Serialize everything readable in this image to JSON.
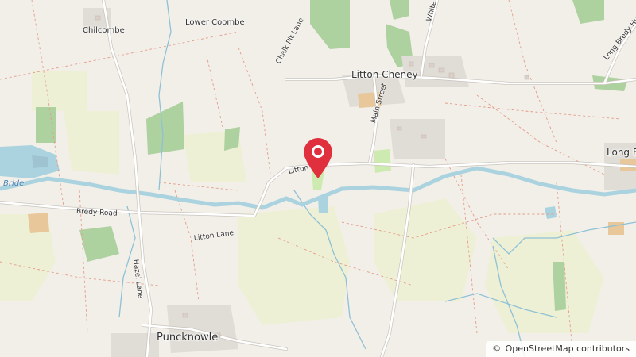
{
  "map": {
    "places": {
      "chilcombe": "Chilcombe",
      "lower_coombe": "Lower Coombe",
      "litton_cheney": "Litton Cheney",
      "long_bredy": "Long B",
      "puncknowle": "Puncknowle"
    },
    "roads": {
      "chalk_pit_lane": "Chalk Pit Lane",
      "main_street": "Main Street",
      "white": "White",
      "long_bredy_hut": "Long Bredy Hut L",
      "litton": "Litton",
      "bredy_road": "Bredy Road",
      "litton_lane": "Litton Lane",
      "hazel_lane": "Hazel Lane"
    },
    "water": {
      "bride": "Bride"
    },
    "marker": {
      "icon": "location-pin-icon",
      "color": "#e0303e"
    }
  },
  "attribution": {
    "symbol": "©",
    "text": "OpenStreetMap contributors"
  }
}
